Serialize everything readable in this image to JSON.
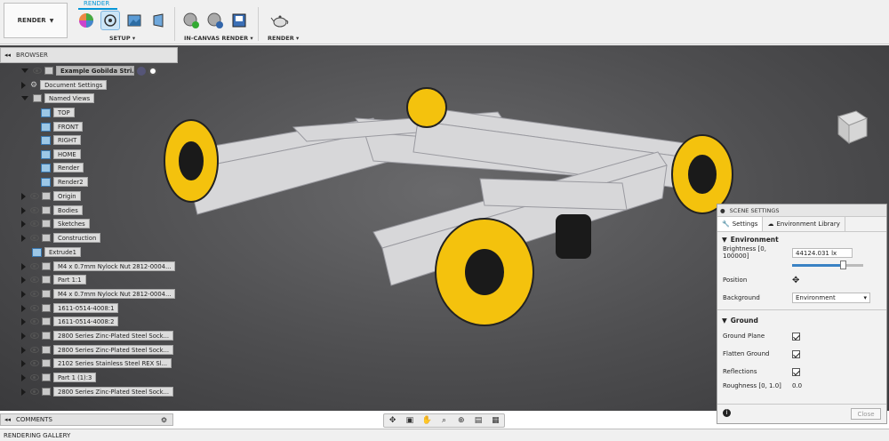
{
  "toolbar": {
    "workspace_label": "RENDER",
    "active_tab": "RENDER",
    "groups": [
      {
        "label": "SETUP ▾"
      },
      {
        "label": "IN-CANVAS RENDER ▾"
      },
      {
        "label": "RENDER ▾"
      }
    ]
  },
  "browser": {
    "title": "BROWSER",
    "root": "Example Gobilda Stri...",
    "items": [
      {
        "label": "Document Settings"
      },
      {
        "label": "Named Views"
      },
      {
        "label": "TOP"
      },
      {
        "label": "FRONT"
      },
      {
        "label": "RIGHT"
      },
      {
        "label": "HOME"
      },
      {
        "label": "Render"
      },
      {
        "label": "Render2"
      },
      {
        "label": "Origin"
      },
      {
        "label": "Bodies"
      },
      {
        "label": "Sketches"
      },
      {
        "label": "Construction"
      },
      {
        "label": "Extrude1"
      },
      {
        "label": "M4 x 0.7mm Nylock Nut 2812-0004..."
      },
      {
        "label": "Part 1:1"
      },
      {
        "label": "M4 x 0.7mm Nylock Nut 2812-0004..."
      },
      {
        "label": "1611-0514-4008:1"
      },
      {
        "label": "1611-0514-4008:2"
      },
      {
        "label": "2800 Series Zinc-Plated Steel Sock..."
      },
      {
        "label": "2800 Series Zinc-Plated Steel Sock..."
      },
      {
        "label": "2102 Series Stainless Steel REX Sl..."
      },
      {
        "label": "Part 1 (1):3"
      },
      {
        "label": "2800 Series Zinc-Plated Steel Sock..."
      }
    ]
  },
  "comments": {
    "title": "COMMENTS"
  },
  "gallery": {
    "title": "RENDERING GALLERY"
  },
  "scene_settings": {
    "title": "SCENE SETTINGS",
    "tabs": [
      {
        "label": "Settings"
      },
      {
        "label": "Environment Library"
      }
    ],
    "environment": {
      "title": "Environment",
      "brightness_label": "Brightness [0, 100000]",
      "brightness_value": "44124.031 lx",
      "position_label": "Position",
      "background_label": "Background",
      "background_value": "Environment"
    },
    "ground": {
      "title": "Ground",
      "ground_plane_label": "Ground Plane",
      "flatten_ground_label": "Flatten Ground",
      "reflections_label": "Reflections",
      "roughness_label": "Roughness [0, 1.0]",
      "roughness_value": "0.0"
    },
    "close_label": "Close"
  },
  "colors": {
    "accent": "#0696d7",
    "wheel_yellow": "#f4c20d"
  }
}
